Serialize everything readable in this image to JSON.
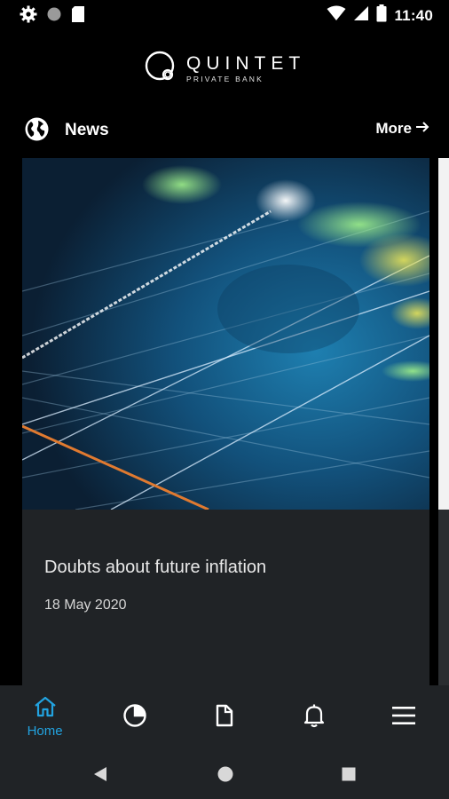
{
  "status_bar": {
    "time": "11:40",
    "icons": [
      "gear-icon",
      "circle-icon",
      "sim-card-icon",
      "wifi-icon",
      "signal-icon",
      "battery-icon"
    ]
  },
  "header": {
    "logo_name": "QUINTET",
    "logo_subtitle": "PRIVATE BANK"
  },
  "section": {
    "icon": "globe-icon",
    "title": "News",
    "more_label": "More"
  },
  "news": {
    "cards": [
      {
        "title": "Doubts about future inflation",
        "date": "18 May 2020",
        "image": "financial-chart-photo"
      }
    ]
  },
  "bottom_nav": {
    "items": [
      {
        "label": "Home",
        "icon": "home-icon",
        "active": true
      },
      {
        "label": "",
        "icon": "pie-chart-icon",
        "active": false
      },
      {
        "label": "",
        "icon": "document-icon",
        "active": false
      },
      {
        "label": "",
        "icon": "bell-icon",
        "active": false
      },
      {
        "label": "",
        "icon": "menu-icon",
        "active": false
      }
    ]
  },
  "colors": {
    "accent": "#22a3e0",
    "background": "#000000",
    "card_background": "#202326",
    "nav_background": "#202326"
  }
}
